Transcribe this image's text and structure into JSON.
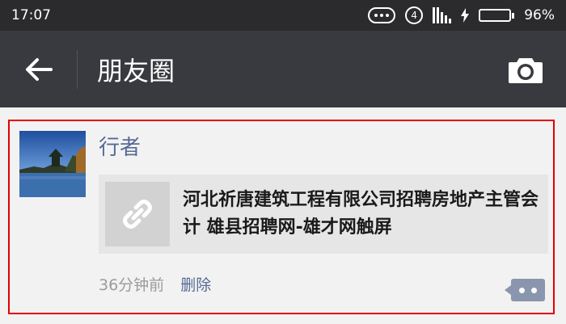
{
  "status_bar": {
    "time": "17:07",
    "sim_number": "4",
    "battery_percent_text": "96%",
    "battery_level": 0.96,
    "battery_color": "#3ddc57",
    "icons": [
      "more-dots-icon",
      "sim-slot-icon",
      "signal-icon",
      "charging-bolt-icon",
      "battery-icon"
    ]
  },
  "header": {
    "title": "朋友圈",
    "back_icon": "arrow-left-icon",
    "camera_icon": "camera-icon"
  },
  "post": {
    "author": "行者",
    "link": {
      "title": "河北祈唐建筑工程有限公司招聘房地产主管会计 雄县招聘网-雄才网触屏",
      "thumb_icon": "link-chain-icon"
    },
    "time_ago": "36分钟前",
    "delete_label": "删除",
    "comment_icon": "comment-dots-icon",
    "accent_color": "#576b95",
    "highlight_border_color": "#e30000"
  }
}
